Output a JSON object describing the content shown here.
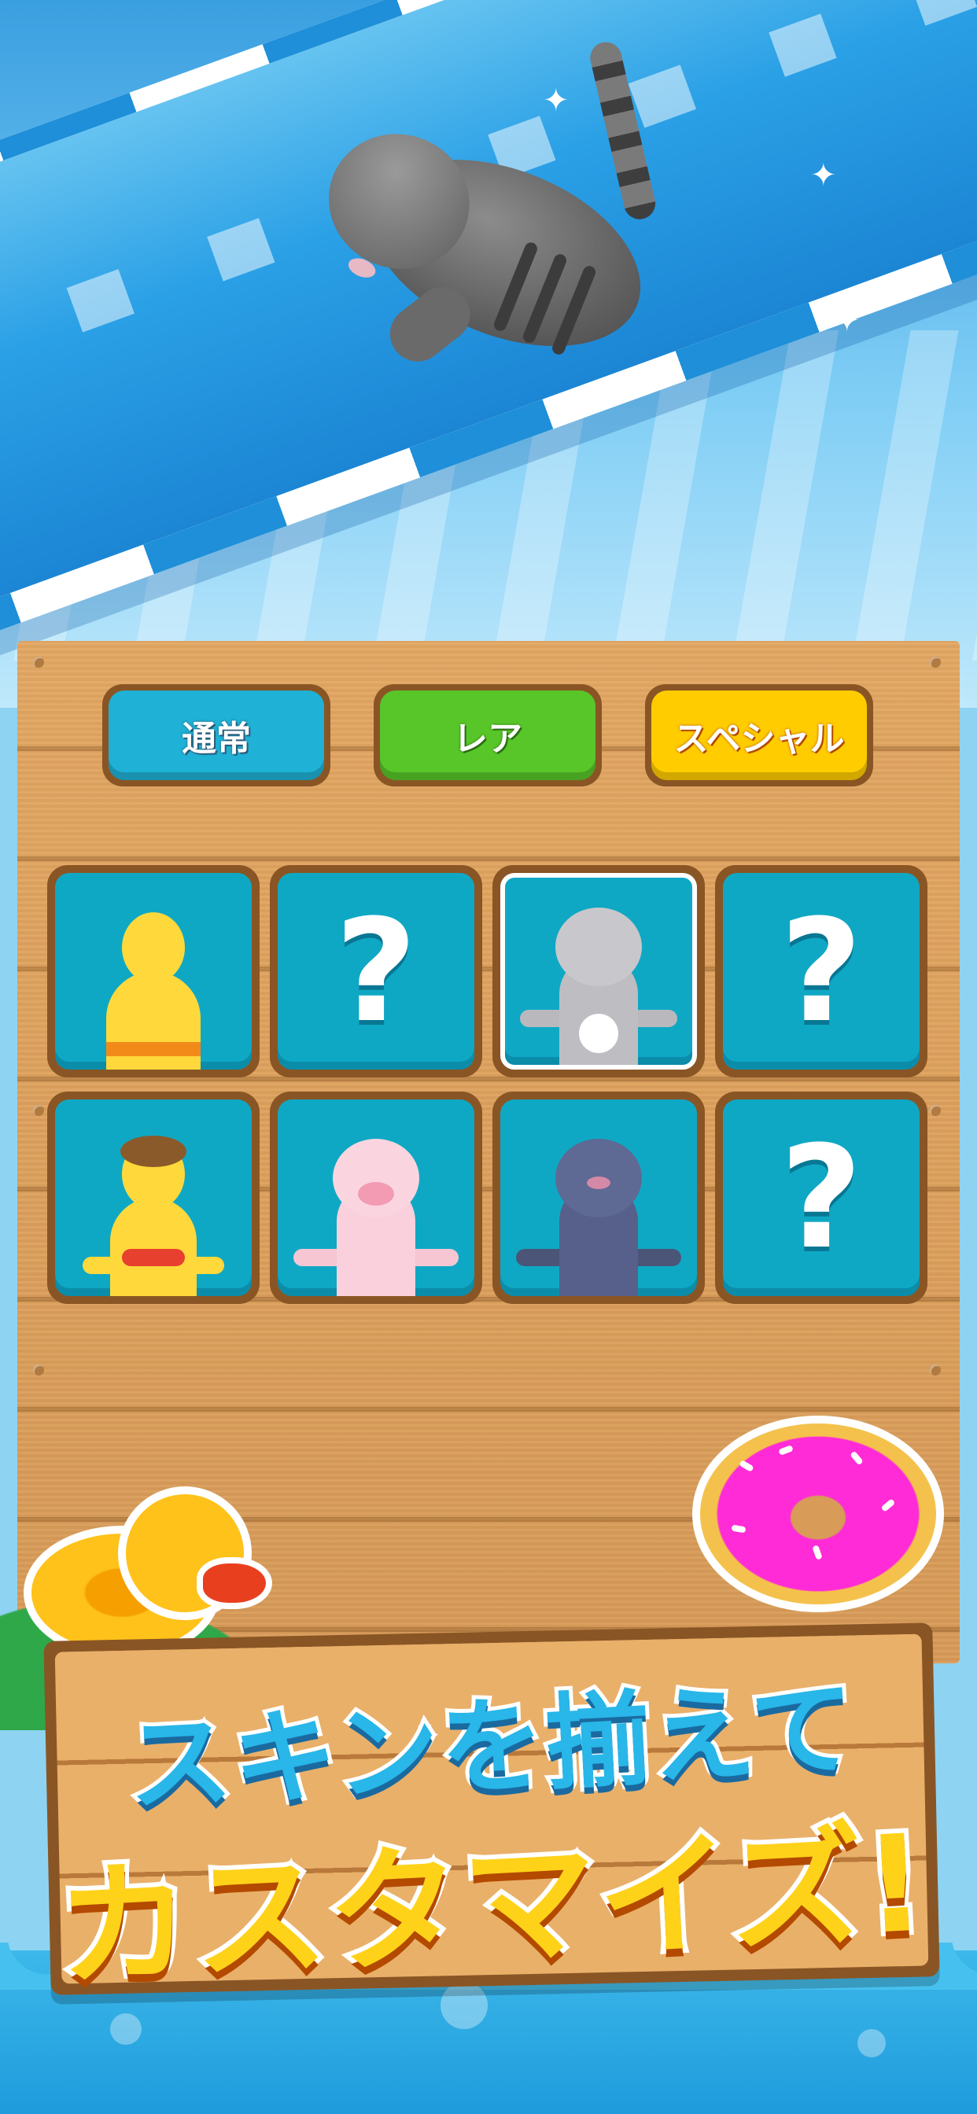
{
  "tabs": [
    {
      "label": "通常"
    },
    {
      "label": "レア"
    },
    {
      "label": "スペシャル"
    }
  ],
  "skins": [
    {
      "id": "yellow-boy",
      "locked": false,
      "selected": false
    },
    {
      "id": "locked",
      "locked": true,
      "symbol": "?"
    },
    {
      "id": "gray-cat",
      "locked": false,
      "selected": true
    },
    {
      "id": "locked",
      "locked": true,
      "symbol": "?"
    },
    {
      "id": "bikini-girl",
      "locked": false,
      "selected": false
    },
    {
      "id": "pink-pig",
      "locked": false,
      "selected": false
    },
    {
      "id": "navy-cat",
      "locked": false,
      "selected": false
    },
    {
      "id": "locked",
      "locked": true,
      "symbol": "?"
    }
  ],
  "banner": {
    "line1": "スキンを揃えて",
    "line2": "カスタマイズ!"
  },
  "colors": {
    "tab_normal": "#1fb1d6",
    "tab_rare": "#58c629",
    "tab_special": "#ffcc00",
    "cell_bg": "#0fa8c4",
    "wood": "#d89b58",
    "headline1": "#29b6e8",
    "headline2": "#ffd21a"
  },
  "icons": [
    "duck-float-icon",
    "donut-float-icon",
    "question-mark-icon"
  ]
}
